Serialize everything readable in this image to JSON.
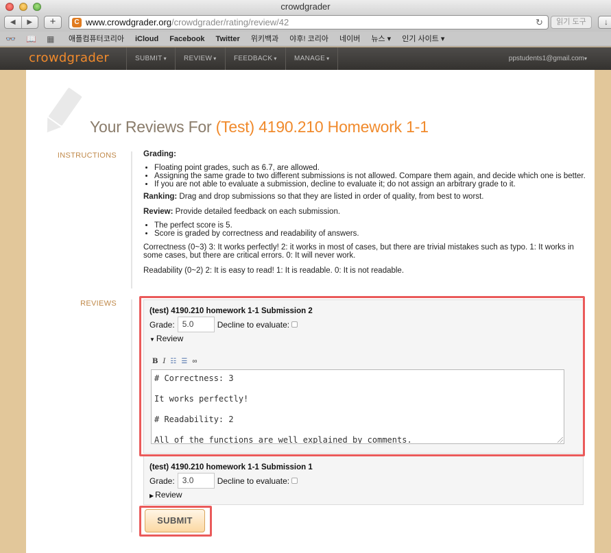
{
  "browser": {
    "window_title": "crowdgrader",
    "url_host": "www.crowdgrader.org",
    "url_path": "/crowdgrader/rating/review/42",
    "reader_label": "읽기 도구",
    "bookmarks": [
      "애플컴퓨터코리아",
      "iCloud",
      "Facebook",
      "Twitter",
      "위키백과",
      "야후! 코리아",
      "네이버",
      "뉴스 ▾",
      "인기 사이트 ▾"
    ]
  },
  "nav": {
    "logo": "crowdgrader",
    "items": [
      "SUBMIT",
      "REVIEW",
      "FEEDBACK",
      "MANAGE"
    ],
    "user": "ppstudents1@gmail.com"
  },
  "page": {
    "title_prefix": "Your Reviews For ",
    "title_highlight": "(Test) 4190.210 Homework 1-1",
    "instructions_label": "INSTRUCTIONS",
    "reviews_label": "REVIEWS"
  },
  "instructions": {
    "grading_heading": "Grading:",
    "grading_items": [
      "Floating point grades, such as 6.7, are allowed.",
      "Assigning the same grade to two different submissions is not allowed. Compare them again, and decide which one is better.",
      "If you are not able to evaluate a submission, decline to evaluate it; do not assign an arbitrary grade to it."
    ],
    "ranking_heading": "Ranking:",
    "ranking_text": " Drag and drop submissions so that they are listed in order of quality, from best to worst.",
    "review_heading": "Review:",
    "review_text": " Provide detailed feedback on each submission.",
    "review_items": [
      "The perfect score is 5.",
      "Score is graded by correctness and readability of answers."
    ],
    "correctness_text": "Correctness (0~3) 3: It works perfectly! 2: it works in most of cases, but there are trivial mistakes such as typo. 1: It works in some cases, but there are critical errors. 0: It will never work.",
    "readability_text": "Readability (0~2) 2: It is easy to read! 1: It is readable. 0: It is not readable."
  },
  "reviews": [
    {
      "title": "(test) 4190.210 homework 1-1 Submission 2",
      "grade_label": "Grade:",
      "grade": "5.0",
      "decline_label": "Decline to evaluate:",
      "review_toggle": "Review",
      "editor_lines": [
        "# Correctness: 3",
        "It works perfectly!",
        "# Readability: 2",
        "All of the functions are well explained by comments."
      ]
    },
    {
      "title": "(test) 4190.210 homework 1-1 Submission 1",
      "grade_label": "Grade:",
      "grade": "3.0",
      "decline_label": "Decline to evaluate:",
      "review_toggle": "Review"
    }
  ],
  "submit_label": "SUBMIT",
  "colors": {
    "accent": "#f08a2c",
    "highlight_box": "#ea5a5a",
    "label": "#c0894a"
  }
}
